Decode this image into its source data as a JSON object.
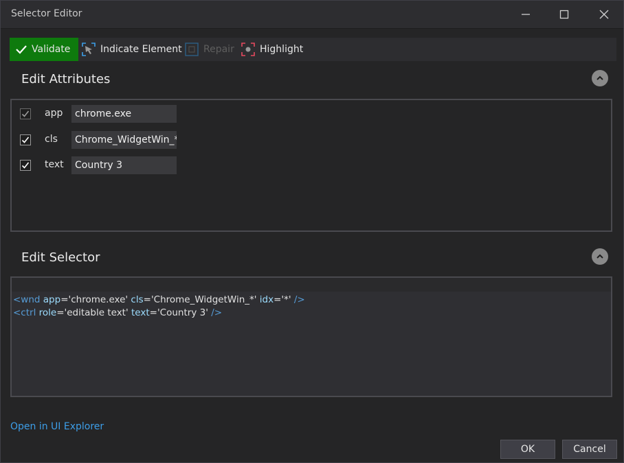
{
  "window": {
    "title": "Selector Editor"
  },
  "toolbar": {
    "validate_label": "Validate",
    "indicate_label": "Indicate Element",
    "repair_label": "Repair",
    "highlight_label": "Highlight"
  },
  "attributes_section": {
    "title": "Edit Attributes",
    "rows": [
      {
        "checked": true,
        "name": "app",
        "value": "chrome.exe"
      },
      {
        "checked": true,
        "name": "cls",
        "value": "Chrome_WidgetWin_*"
      },
      {
        "checked": true,
        "name": "text",
        "value": "Country 3"
      }
    ]
  },
  "selector_section": {
    "title": "Edit Selector",
    "line1": {
      "open": "<wnd",
      "a1": "app",
      "v1": "='chrome.exe'",
      "a2": "cls",
      "v2": "='Chrome_WidgetWin_*'",
      "a3": "idx",
      "v3": "='*'",
      "close": "/>"
    },
    "line2": {
      "open": "<ctrl",
      "a1": "role",
      "v1": "='editable text'",
      "a2": "text",
      "v2": "='Country 3'",
      "close": "/>"
    }
  },
  "footer": {
    "explorer_link": "Open in UI Explorer",
    "ok_label": "OK",
    "cancel_label": "Cancel"
  },
  "colors": {
    "validate_bg": "#0e7a0d",
    "link": "#3d9ee8",
    "tag": "#569cd6",
    "attr": "#9cdcfe"
  },
  "icons": {
    "validate": "check-icon",
    "indicate": "cursor-target-icon",
    "repair": "repair-icon",
    "highlight": "highlight-icon",
    "collapse": "chevron-up-icon"
  }
}
